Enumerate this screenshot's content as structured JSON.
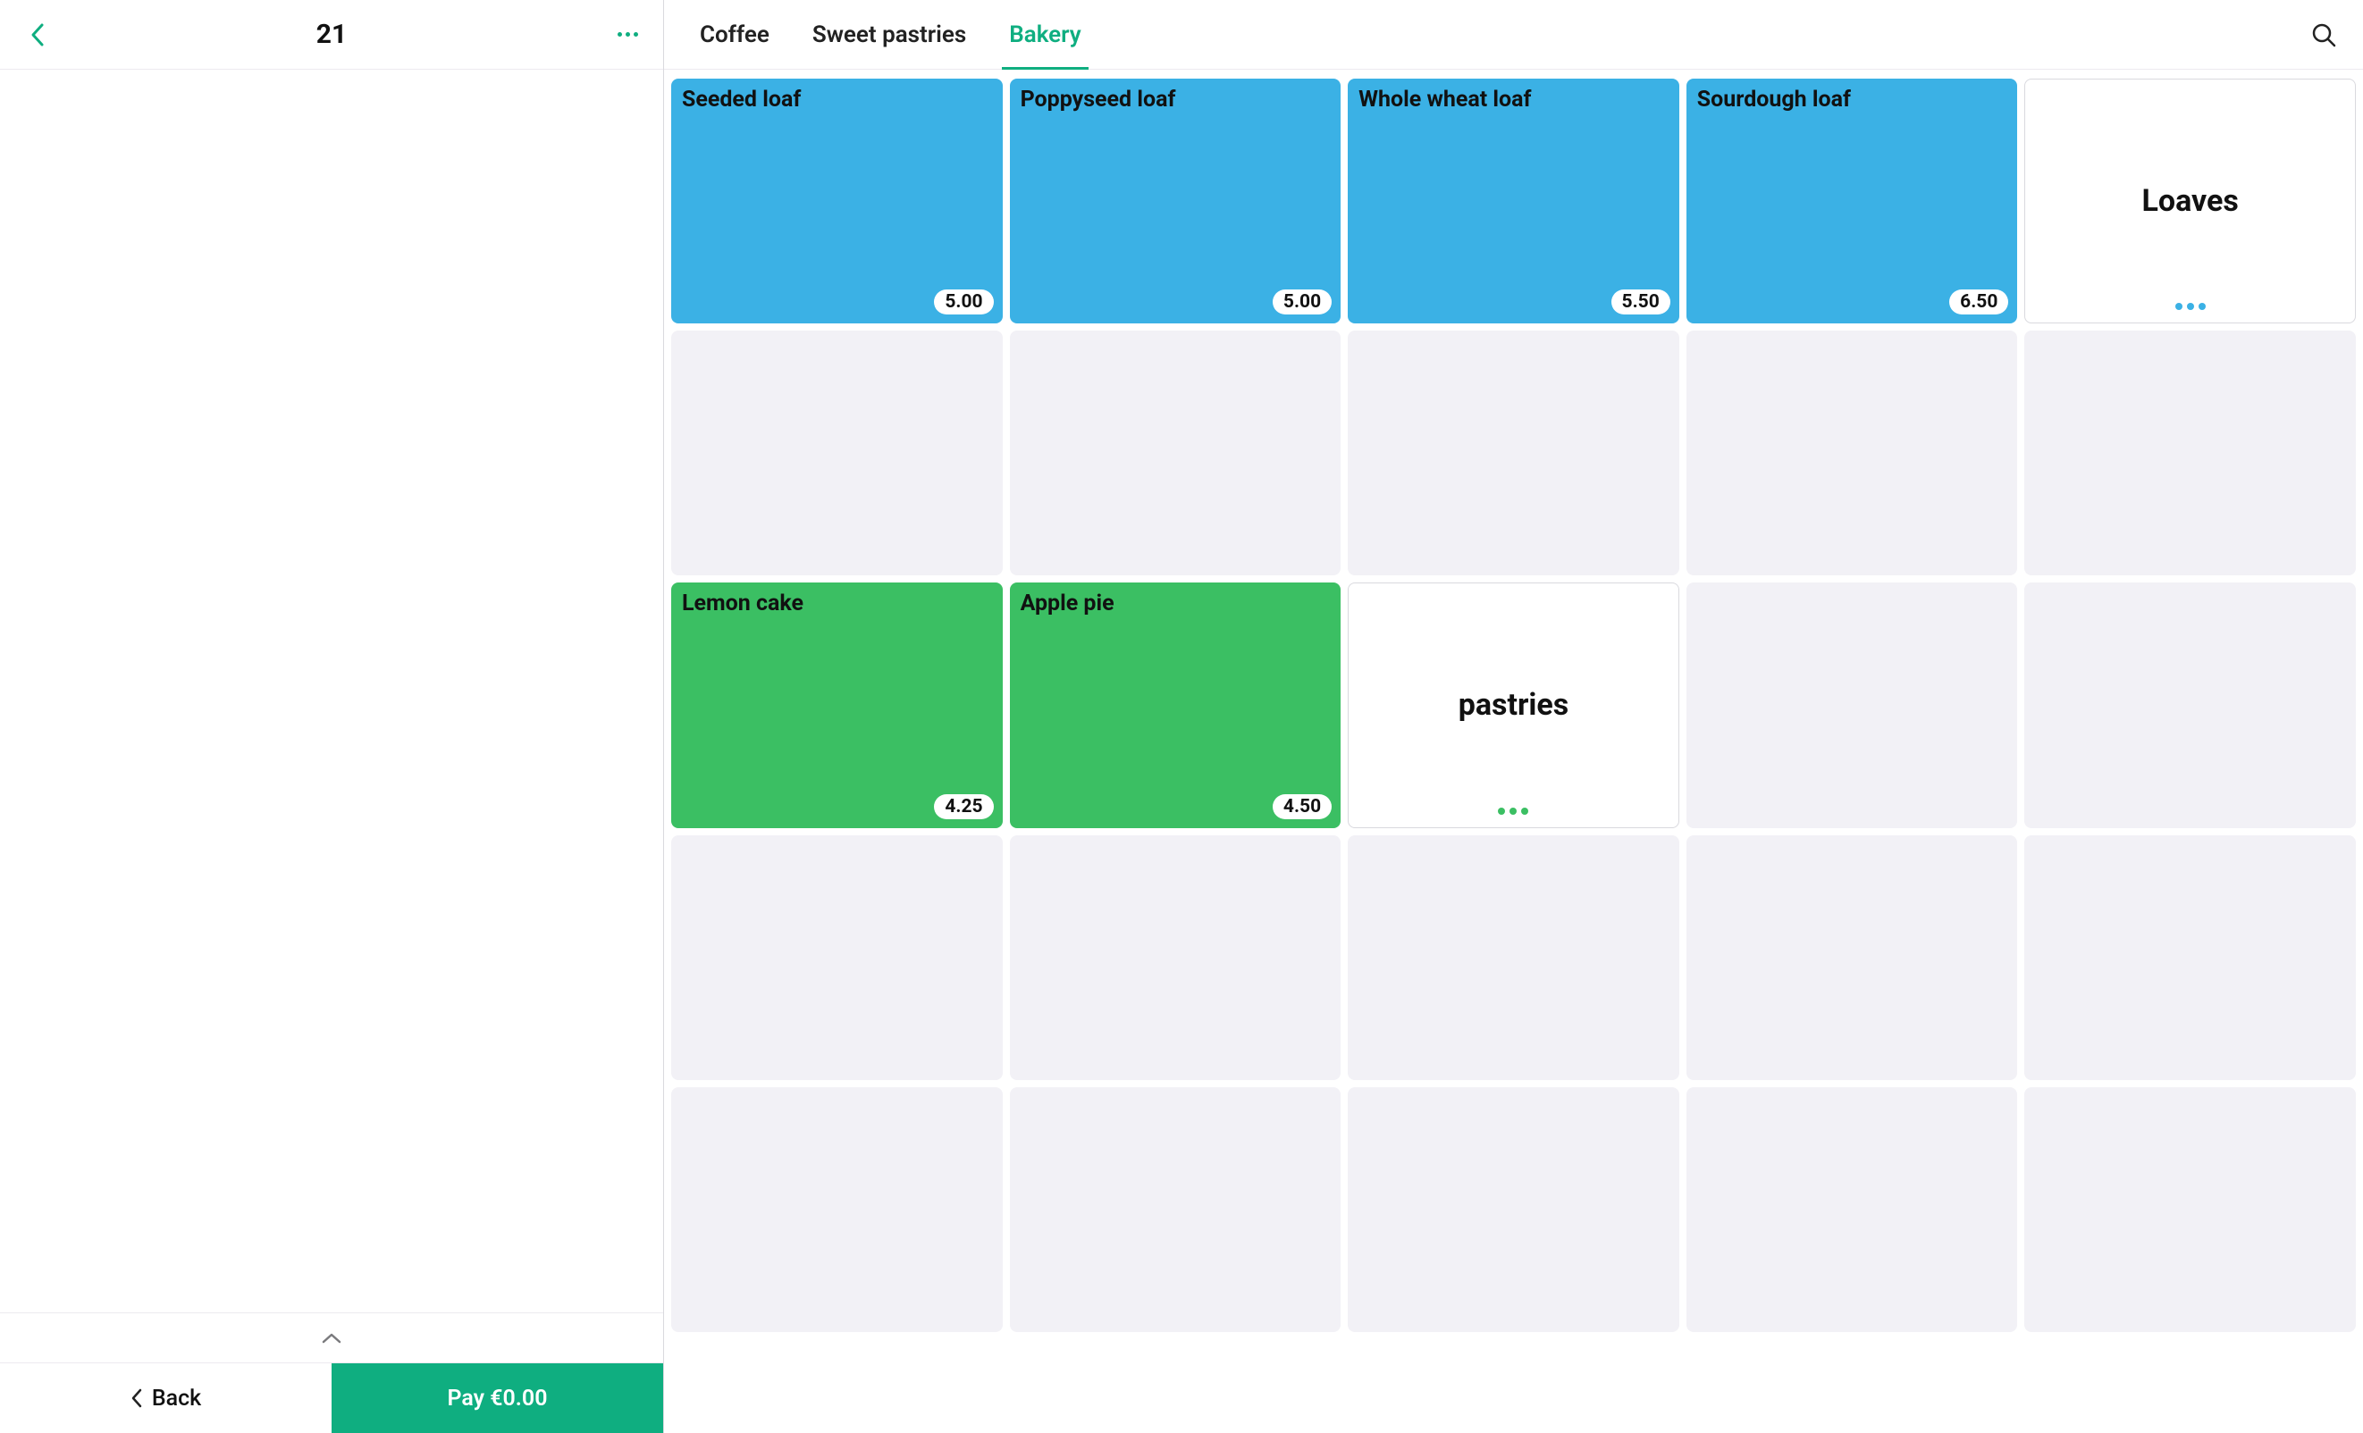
{
  "sidebar": {
    "title": "21",
    "back_label": "Back",
    "pay_label": "Pay €0.00"
  },
  "tabs": [
    {
      "label": "Coffee",
      "active": false
    },
    {
      "label": "Sweet pastries",
      "active": false
    },
    {
      "label": "Bakery",
      "active": true
    }
  ],
  "grid": {
    "rows": 5,
    "cols": 5,
    "cells": [
      {
        "row": 0,
        "col": 0,
        "type": "product",
        "color": "blue",
        "name": "Seeded loaf",
        "price": "5.00"
      },
      {
        "row": 0,
        "col": 1,
        "type": "product",
        "color": "blue",
        "name": "Poppyseed loaf",
        "price": "5.00"
      },
      {
        "row": 0,
        "col": 2,
        "type": "product",
        "color": "blue",
        "name": "Whole wheat loaf",
        "price": "5.50"
      },
      {
        "row": 0,
        "col": 3,
        "type": "product",
        "color": "blue",
        "name": "Sourdough loaf",
        "price": "6.50"
      },
      {
        "row": 0,
        "col": 4,
        "type": "category",
        "dot_color": "blue",
        "label": "Loaves"
      },
      {
        "row": 2,
        "col": 0,
        "type": "product",
        "color": "green",
        "name": "Lemon cake",
        "price": "4.25"
      },
      {
        "row": 2,
        "col": 1,
        "type": "product",
        "color": "green",
        "name": "Apple pie",
        "price": "4.50"
      },
      {
        "row": 2,
        "col": 2,
        "type": "category",
        "dot_color": "green",
        "label": "pastries"
      }
    ]
  }
}
